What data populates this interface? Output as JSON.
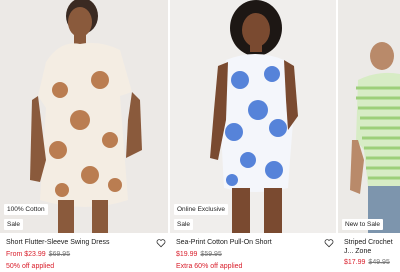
{
  "products": [
    {
      "badges": [
        "100% Cotton",
        "Sale"
      ],
      "name": "Short Flutter-Sleeve Swing Dress",
      "sale_price": "From $23.99",
      "original_price": "$69.95",
      "promo": "50% off applied",
      "wishlist_icon": "heart-outline-icon"
    },
    {
      "badges": [
        "Online Exclusive",
        "Sale"
      ],
      "name": "Sea-Print Cotton Pull-On Short",
      "sale_price": "$19.99",
      "original_price": "$59.95",
      "promo": "Extra 60% off applied",
      "wishlist_icon": "heart-outline-icon"
    },
    {
      "badges": [
        "New to Sale"
      ],
      "name": "Striped Crochet J... Zone",
      "sale_price": "$17.99",
      "original_price": "$49.95",
      "promo": "",
      "wishlist_icon": "heart-outline-icon"
    }
  ],
  "colors": {
    "sale_red": "#d91e2b",
    "strike_gray": "#7a7a7a"
  }
}
